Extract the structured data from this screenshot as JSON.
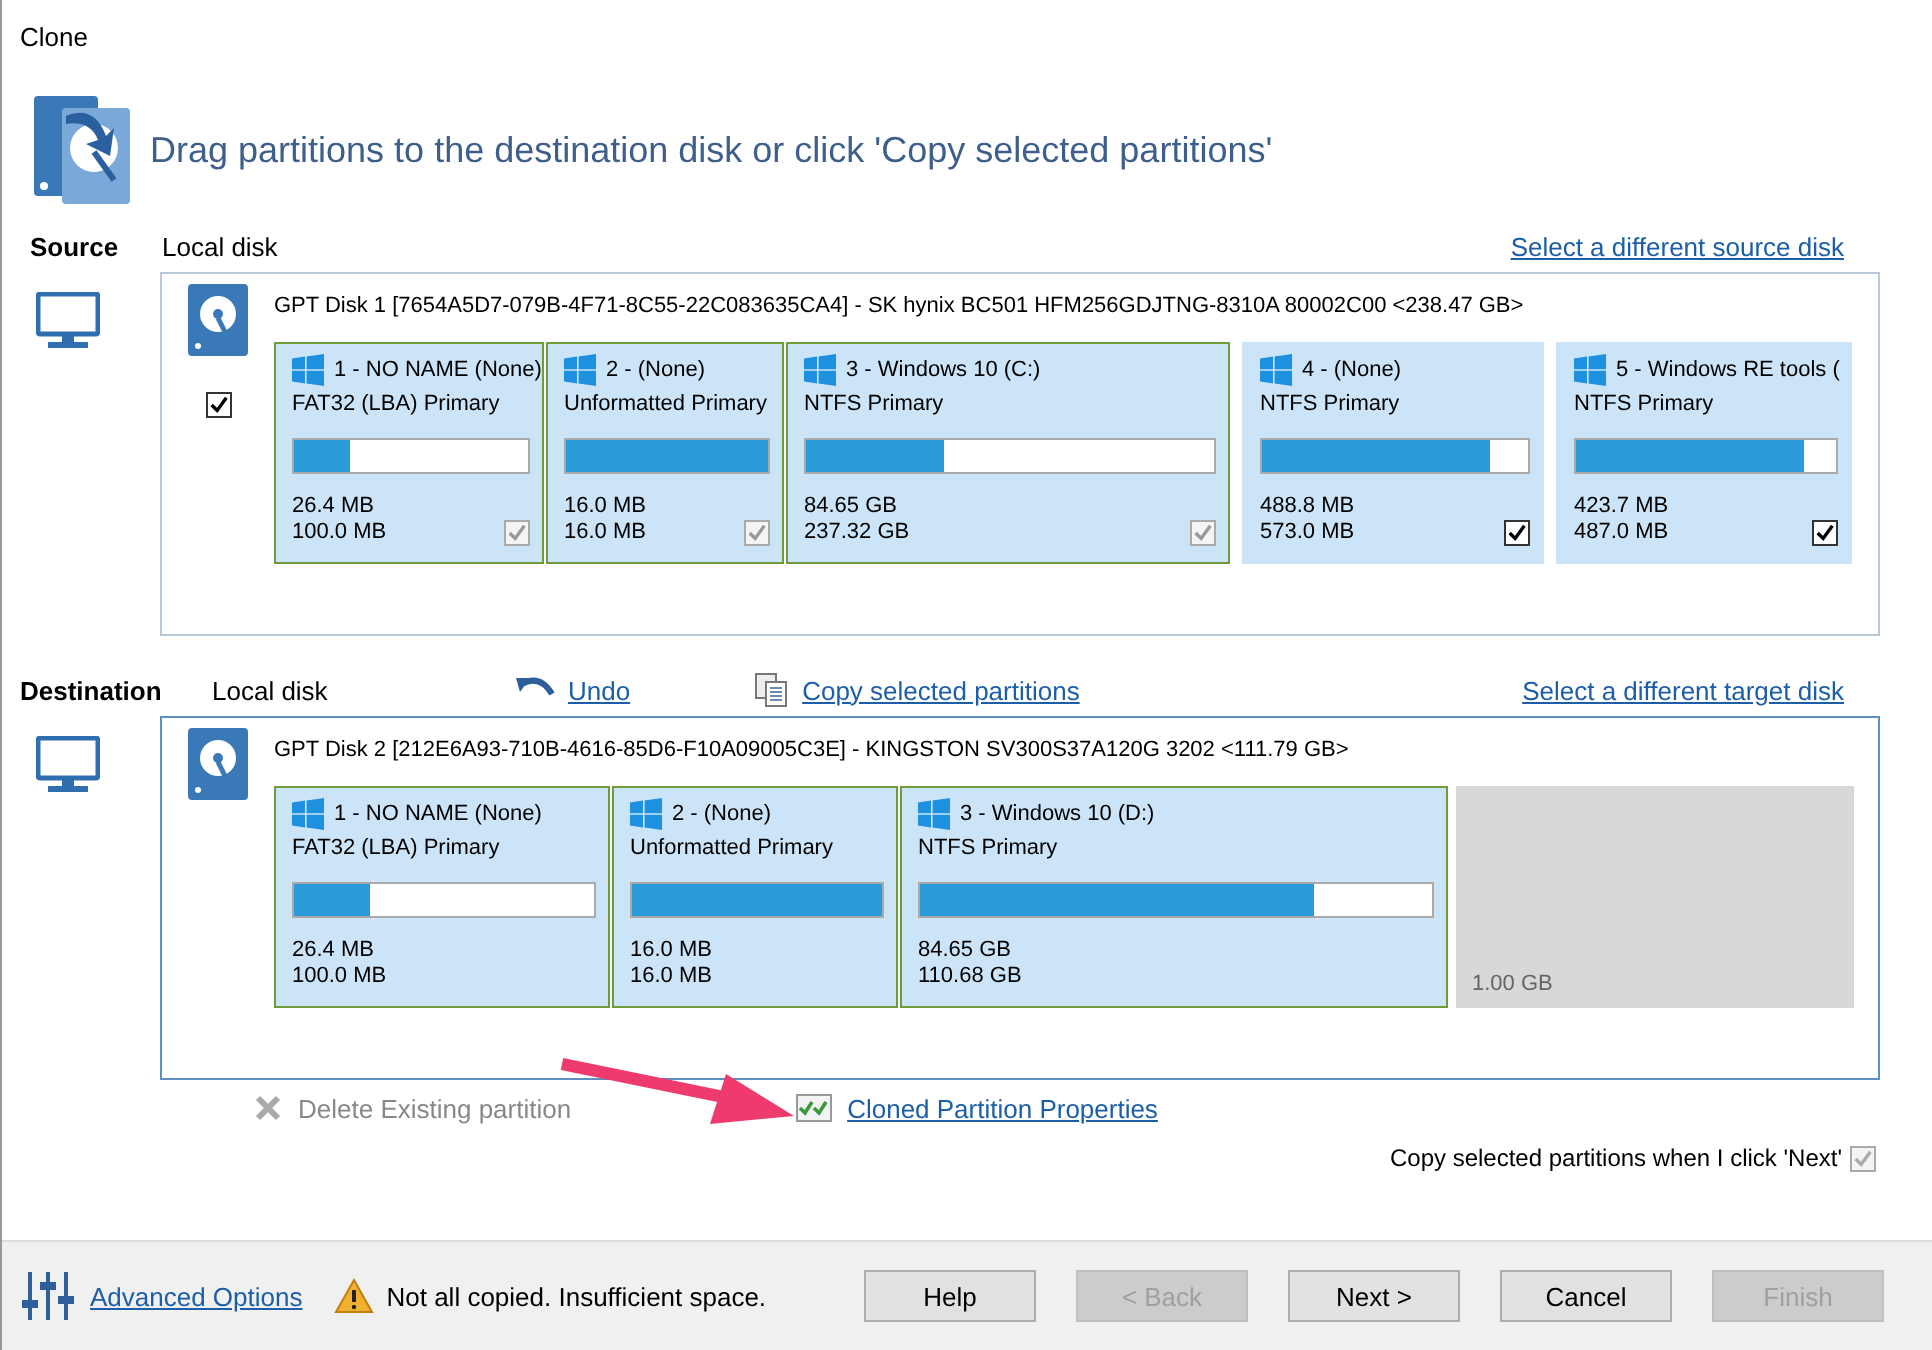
{
  "window": {
    "title": "Clone"
  },
  "header": {
    "instruction": "Drag partitions to the destination disk or click 'Copy selected partitions'"
  },
  "source": {
    "label": "Source",
    "disk_type": "Local disk",
    "link": "Select a different source disk",
    "disk": {
      "description": "GPT Disk 1 [7654A5D7-079B-4F71-8C55-22C083635CA4] - SK hynix BC501 HFM256GDJTNG-8310A 80002C00  <238.47 GB>",
      "checked": true,
      "partitions": [
        {
          "kind": "partition",
          "title": "1 - NO NAME (None)",
          "filesystem": "FAT32 (LBA) Primary",
          "level": 0.24,
          "used": "26.4 MB",
          "total": "100.0 MB",
          "selected": true,
          "checked": true,
          "disabled": true
        },
        {
          "kind": "partition",
          "title": "2 -  (None)",
          "filesystem": "Unformatted Primary",
          "level": 1,
          "used": "16.0 MB",
          "total": "16.0 MB",
          "selected": true,
          "checked": true,
          "disabled": true
        },
        {
          "kind": "partition",
          "title": "3 - Windows 10 (C:)",
          "filesystem": "NTFS Primary",
          "level": 0.34,
          "used": "84.65 GB",
          "total": "237.32 GB",
          "selected": true,
          "checked": true,
          "disabled": true
        },
        {
          "kind": "partition",
          "title": "4 -  (None)",
          "filesystem": "NTFS Primary",
          "level": 0.86,
          "used": "488.8 MB",
          "total": "573.0 MB",
          "selected": false,
          "checked": true,
          "disabled": false
        },
        {
          "kind": "partition",
          "title": "5 - Windows RE tools (",
          "filesystem": "NTFS Primary",
          "level": 0.88,
          "used": "423.7 MB",
          "total": "487.0 MB",
          "selected": false,
          "checked": true,
          "disabled": false
        }
      ]
    }
  },
  "destination": {
    "label": "Destination",
    "disk_type": "Local disk",
    "actions": [
      {
        "kind": "undo",
        "label": "Undo"
      },
      {
        "kind": "copy",
        "label": "Copy selected partitions"
      }
    ],
    "link": "Select a different target disk",
    "disk": {
      "description": "GPT Disk 2 [212E6A93-710B-4616-85D6-F10A09005C3E] - KINGSTON  SV300S37A120G   3202  <111.79 GB>",
      "partitions": [
        {
          "kind": "partition",
          "title": "1 - NO NAME (None)",
          "filesystem": "FAT32 (LBA) Primary",
          "level": 0.25,
          "used": "26.4 MB",
          "total": "100.0 MB",
          "selected": true
        },
        {
          "kind": "partition",
          "title": "2 -  (None)",
          "filesystem": "Unformatted Primary",
          "level": 1,
          "used": "16.0 MB",
          "total": "16.0 MB",
          "selected": true
        },
        {
          "kind": "partition",
          "title": "3 - Windows 10 (D:)",
          "filesystem": "NTFS Primary",
          "level": 0.77,
          "used": "84.65 GB",
          "total": "110.68 GB",
          "selected": true
        },
        {
          "kind": "unallocated",
          "size": "1.00 GB"
        }
      ]
    }
  },
  "partition_actions": [
    {
      "kind": "delete",
      "label": "Delete Existing partition",
      "disabled": true
    },
    {
      "kind": "properties",
      "label": "Cloned Partition Properties",
      "disabled": false
    }
  ],
  "copy_option": {
    "label": "Copy selected partitions when I click 'Next'",
    "checked": true,
    "disabled": true
  },
  "footer": {
    "advanced_link": "Advanced Options",
    "warning": "Not all copied. Insufficient space.",
    "buttons": [
      {
        "label": "Help",
        "disabled": false
      },
      {
        "label": "< Back",
        "disabled": true
      },
      {
        "label": "Next >",
        "disabled": false
      },
      {
        "label": "Cancel",
        "disabled": false
      },
      {
        "label": "Finish",
        "disabled": true
      }
    ]
  }
}
